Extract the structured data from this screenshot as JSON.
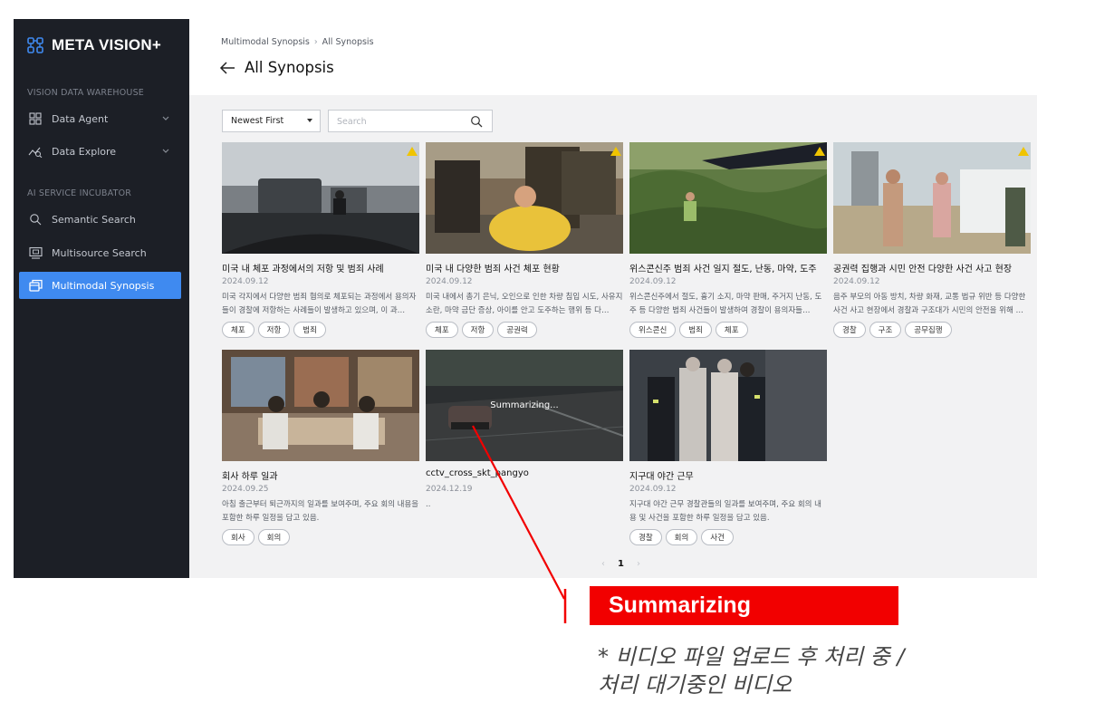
{
  "app": {
    "brand": "META VISION+",
    "sections": [
      "VISION DATA WAREHOUSE",
      "AI SERVICE INCUBATOR"
    ]
  },
  "sidebar": {
    "items": [
      {
        "label": "Data Agent",
        "icon": "grid-icon",
        "has_chevron": true
      },
      {
        "label": "Data Explore",
        "icon": "explore-chart-icon",
        "has_chevron": true
      },
      {
        "label": "Semantic Search",
        "icon": "search-icon",
        "has_chevron": false
      },
      {
        "label": "Multisource Search",
        "icon": "monitor-icon",
        "has_chevron": false
      },
      {
        "label": "Multimodal Synopsis",
        "icon": "stacked-windows-icon",
        "has_chevron": false,
        "active": true
      }
    ]
  },
  "header": {
    "breadcrumb": [
      "Multimodal Synopsis",
      "All Synopsis"
    ],
    "title": "All Synopsis"
  },
  "toolbar": {
    "sort_selected": "Newest First",
    "search_placeholder": "Search"
  },
  "cards": [
    {
      "title": "미국 내 체포 과정에서의 저항 및 범죄 사례",
      "date": "2024.09.12",
      "desc": "미국 각지에서 다양한 범죄 혐의로 체포되는 과정에서 용의자들이 경찰에 저항하는 사례들이 발생하고 있으며, 이 과…",
      "tags": [
        "체포",
        "저항",
        "범죄"
      ]
    },
    {
      "title": "미국 내 다양한 범죄 사건 체포 현황",
      "date": "2024.09.12",
      "desc": "미국 내에서 총기 은닉, 오인으로 인한 차량 침입 시도, 사유지 소란, 마약 금단 증상, 아이를 안고 도주하는 행위 등 다…",
      "tags": [
        "체포",
        "저항",
        "공권력"
      ]
    },
    {
      "title": "위스콘신주 범죄 사건 일지 절도, 난동, 마약, 도주",
      "date": "2024.09.12",
      "desc": "위스콘신주에서 절도, 흉기 소지, 마약 판매, 주거지 난동, 도주 등 다양한 범죄 사건들이 발생하여 경찰이 용의자들…",
      "tags": [
        "위스콘신",
        "범죄",
        "체포"
      ]
    },
    {
      "title": "공권력 집행과 시민 안전 다양한 사건 사고 현장",
      "date": "2024.09.12",
      "desc": "음주 부모의 아동 방치, 차량 화재, 교통 법규 위반 등 다양한 사건 사고 현장에서 경찰과 구조대가 시민의 안전을 위해 …",
      "tags": [
        "경찰",
        "구조",
        "공무집행"
      ]
    },
    {
      "title": "회사 하루 일과",
      "date": "2024.09.25",
      "desc": "아침 출근부터 퇴근까지의 일과를 보여주며, 주요 회의 내용을 포함한 하루 일정을 담고 있음.",
      "tags": [
        "회사",
        "회의"
      ]
    },
    {
      "title": "cctv_cross_skt_pangyo",
      "date": "2024.12.19",
      "desc": "..",
      "tags": [],
      "overlay": "Summarizing..."
    },
    {
      "title": "지구대 야간 근무",
      "date": "2024.09.12",
      "desc": "지구대 야간 근무 경찰관들의 일과를 보여주며, 주요 회의 내용 및 사건을 포함한 하루 일정을 담고 있음.",
      "tags": [
        "경찰",
        "회의",
        "사건"
      ]
    }
  ],
  "pagination": {
    "current": "1"
  },
  "annotation": {
    "label": "Summarizing",
    "note_line1": "* 비디오 파일 업로드 후 처리 중 /",
    "note_line2": "처리 대기중인 비디오",
    "color": "#f20000"
  },
  "colors": {
    "sidebar_bg": "#1c1f26",
    "active": "#3f8af0",
    "content_bg": "#f2f2f3"
  }
}
